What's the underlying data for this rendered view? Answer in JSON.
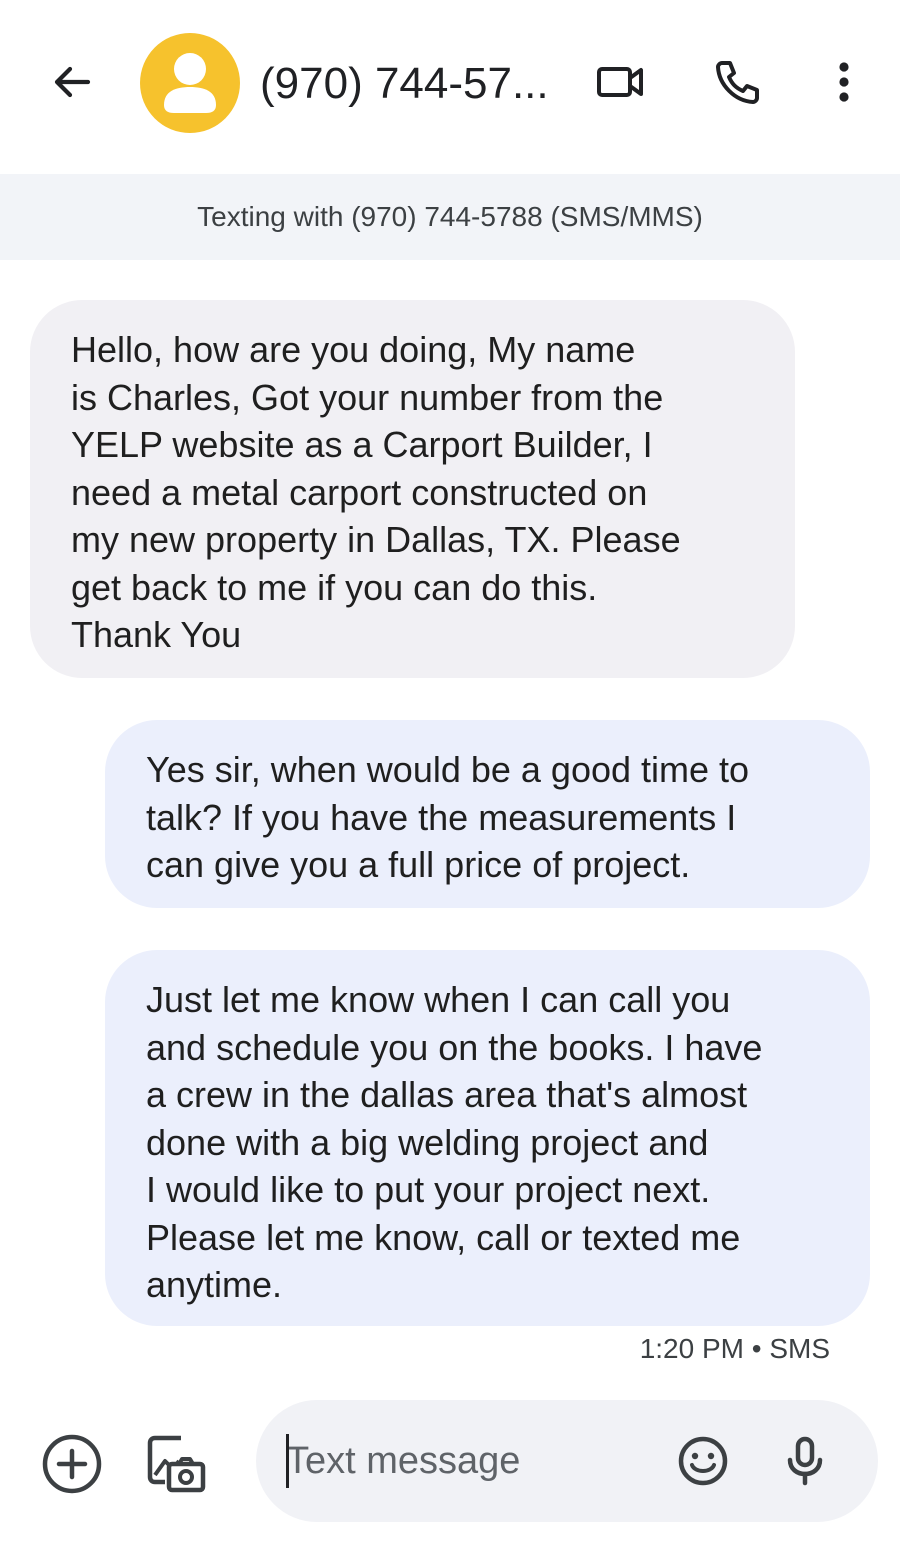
{
  "header": {
    "contact_name": "(970) 744-57...",
    "avatar_icon": "person-icon",
    "back_icon": "arrow-back-icon",
    "video_icon": "video-call-icon",
    "call_icon": "phone-icon",
    "more_icon": "more-vert-icon",
    "avatar_color": "#f6c22d"
  },
  "banner": {
    "text": "Texting with (970) 744-5788 (SMS/MMS)"
  },
  "messages": [
    {
      "direction": "incoming",
      "lines": [
        "Hello, how are you doing, My name",
        "is Charles, Got your number from the",
        "YELP website as a Carport Builder, I",
        "need a metal carport constructed on",
        "my new property in Dallas, TX. Please",
        "get back to me if you can do this.",
        "Thank You"
      ]
    },
    {
      "direction": "outgoing",
      "lines": [
        "Yes sir, when would be a good time to",
        "talk? If you have the measurements I",
        "can give you a full price of project."
      ]
    },
    {
      "direction": "outgoing",
      "lines": [
        "Just let me know when I can call you",
        "and schedule you on the books. I have",
        "a crew in the dallas area that's almost",
        "done with a big welding project and",
        "I would like to put your project next.",
        "Please let me know, call or texted me",
        "anytime."
      ]
    }
  ],
  "last_message_meta": "1:20 PM • SMS",
  "compose": {
    "placeholder": "Text message",
    "add_icon": "add-circle-icon",
    "gallery_icon": "gallery-camera-icon",
    "emoji_icon": "emoji-icon",
    "mic_icon": "mic-icon"
  },
  "colors": {
    "incoming_bubble": "#f1f0f4",
    "outgoing_bubble": "#ebeffc",
    "banner_bg": "#f2f4f8"
  }
}
